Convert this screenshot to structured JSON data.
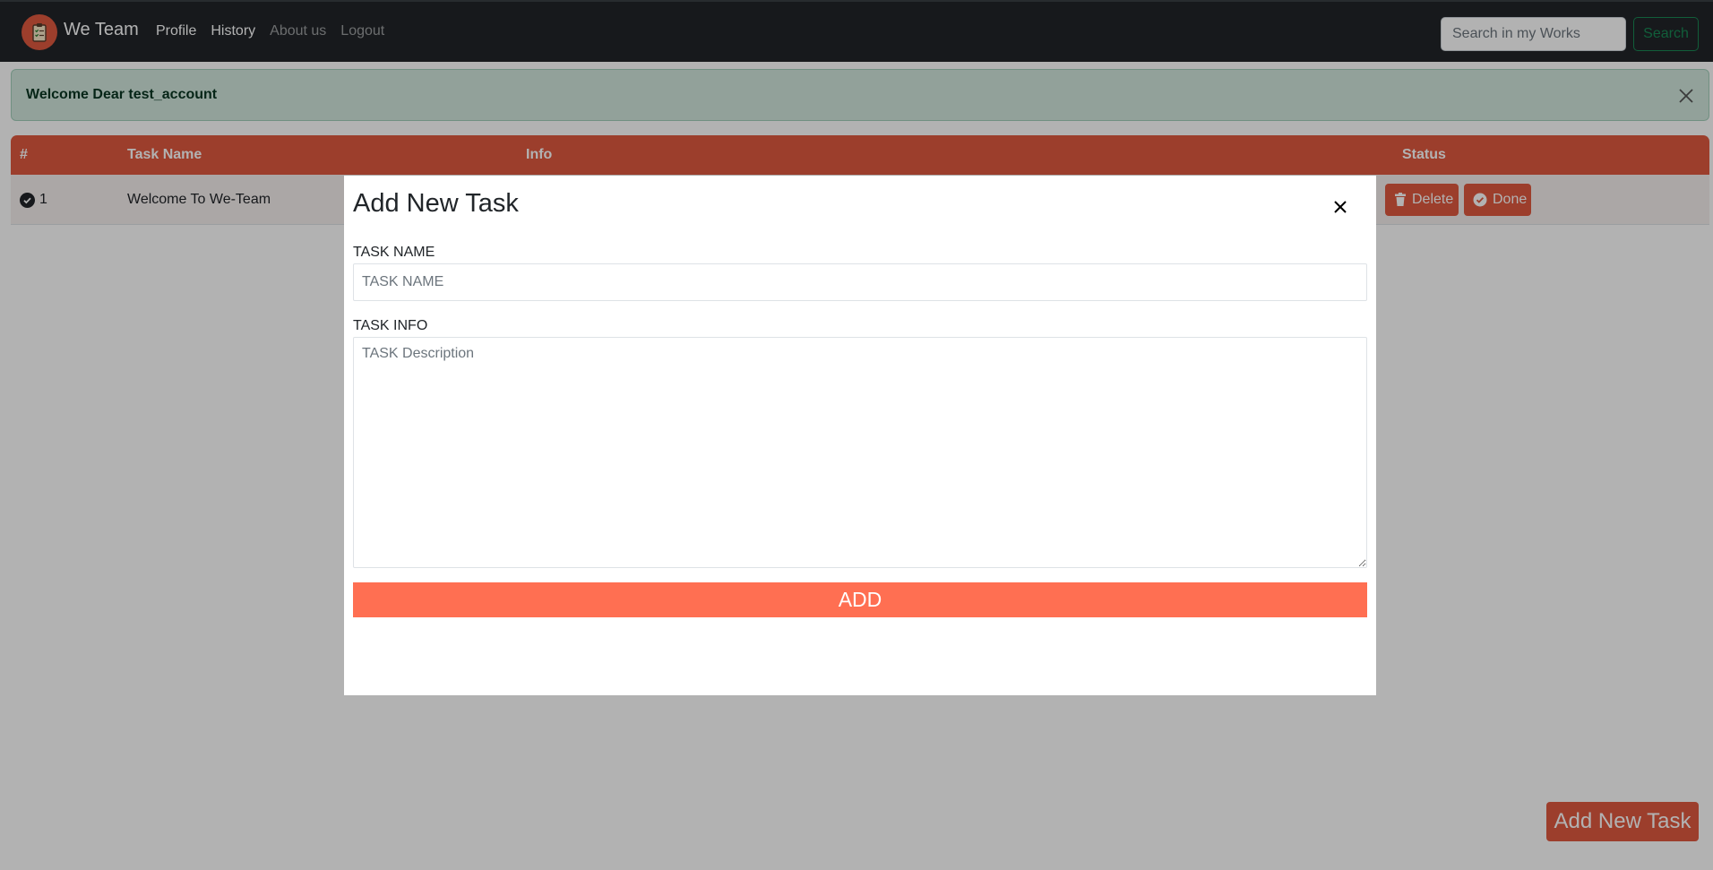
{
  "navbar": {
    "brand": "We Team",
    "logo_icon": "clipboard-icon",
    "links": [
      {
        "label": "Profile",
        "active": true
      },
      {
        "label": "History",
        "active": true
      },
      {
        "label": "About us",
        "active": false
      },
      {
        "label": "Logout",
        "active": false
      }
    ],
    "search_placeholder": "Search in my Works",
    "search_button": "Search"
  },
  "alert": {
    "text": "Welcome Dear test_account",
    "close_icon": "close-icon"
  },
  "table": {
    "headers": [
      "#",
      "Task Name",
      "Info",
      "Status"
    ],
    "rows": [
      {
        "num": "1",
        "task_name": "Welcome To We-Team",
        "delete_label": "Delete",
        "done_label": "Done"
      }
    ]
  },
  "fab_label": "Add New Task",
  "modal": {
    "title": "Add New Task",
    "task_name_label": "TASK NAME",
    "task_name_placeholder": "TASK NAME",
    "task_info_label": "TASK INFO",
    "task_info_placeholder": "TASK Description",
    "add_button": "ADD"
  },
  "colors": {
    "accent": "#e0593f",
    "add_button": "#ff6f52",
    "navbar": "#212529",
    "alert_bg": "#d1e7dd"
  }
}
